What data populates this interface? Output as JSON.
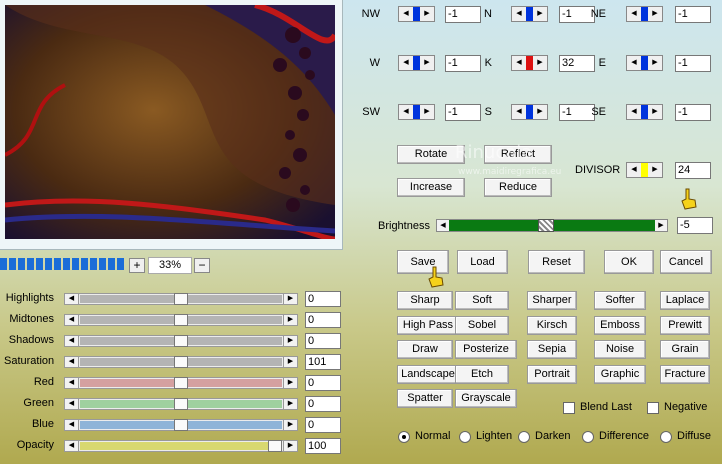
{
  "zoom": {
    "value": "33%",
    "plus": "+",
    "minus": "−"
  },
  "sliders": [
    {
      "label": "Highlights",
      "value": "0",
      "color": "#b4b4b4",
      "pos": 0.5
    },
    {
      "label": "Midtones",
      "value": "0",
      "color": "#b4b4b4",
      "pos": 0.5
    },
    {
      "label": "Shadows",
      "value": "0",
      "color": "#b4b4b4",
      "pos": 0.5
    },
    {
      "label": "Saturation",
      "value": "101",
      "color": "#b4b4b4",
      "pos": 0.5
    },
    {
      "label": "Red",
      "value": "0",
      "color": "#d5a0a0",
      "pos": 0.5
    },
    {
      "label": "Green",
      "value": "0",
      "color": "#9fd09f",
      "pos": 0.5
    },
    {
      "label": "Blue",
      "value": "0",
      "color": "#8fb4d8",
      "pos": 0.5
    },
    {
      "label": "Opacity",
      "value": "100",
      "color": "#d8d870",
      "pos": 1.0
    }
  ],
  "matrix": [
    {
      "label": "NW",
      "value": "-1",
      "color": "#0033dd"
    },
    {
      "label": "N",
      "value": "-1",
      "color": "#0033dd"
    },
    {
      "label": "NE",
      "value": "-1",
      "color": "#0033dd"
    },
    {
      "label": "W",
      "value": "-1",
      "color": "#0033dd"
    },
    {
      "label": "K",
      "value": "32",
      "color": "#dd1111"
    },
    {
      "label": "E",
      "value": "-1",
      "color": "#0033dd"
    },
    {
      "label": "SW",
      "value": "-1",
      "color": "#0033dd"
    },
    {
      "label": "S",
      "value": "-1",
      "color": "#0033dd"
    },
    {
      "label": "SE",
      "value": "-1",
      "color": "#0033dd"
    }
  ],
  "transform_buttons": {
    "rotate": "Rotate",
    "reflect": "Reflect",
    "increase": "Increase",
    "reduce": "Reduce"
  },
  "divisor": {
    "label": "DIVISOR",
    "value": "24",
    "color": "#ffff00"
  },
  "brightness": {
    "label": "Brightness",
    "value": "-5",
    "pos": 0.47
  },
  "actions": {
    "save": "Save",
    "load": "Load",
    "reset": "Reset",
    "ok": "OK",
    "cancel": "Cancel"
  },
  "presets": [
    [
      "Sharp",
      "Soft",
      "Sharper",
      "Softer",
      "Laplace"
    ],
    [
      "High Pass",
      "Sobel",
      "Kirsch",
      "Emboss",
      "Prewitt"
    ],
    [
      "Draw",
      "Posterize",
      "Sepia",
      "Noise",
      "Grain"
    ],
    [
      "Landscape",
      "Etch",
      "Portrait",
      "Graphic",
      "Fracture"
    ],
    [
      "Spatter",
      "Grayscale"
    ]
  ],
  "checks": {
    "blend_last": "Blend Last",
    "negative": "Negative"
  },
  "blend_modes": [
    {
      "label": "Normal",
      "selected": true
    },
    {
      "label": "Lighten",
      "selected": false
    },
    {
      "label": "Darken",
      "selected": false
    },
    {
      "label": "Difference",
      "selected": false
    },
    {
      "label": "Diffuse",
      "selected": false
    }
  ],
  "watermark": {
    "line1": "Rinucaia",
    "line2": "www.maidiregrafica.eu"
  }
}
